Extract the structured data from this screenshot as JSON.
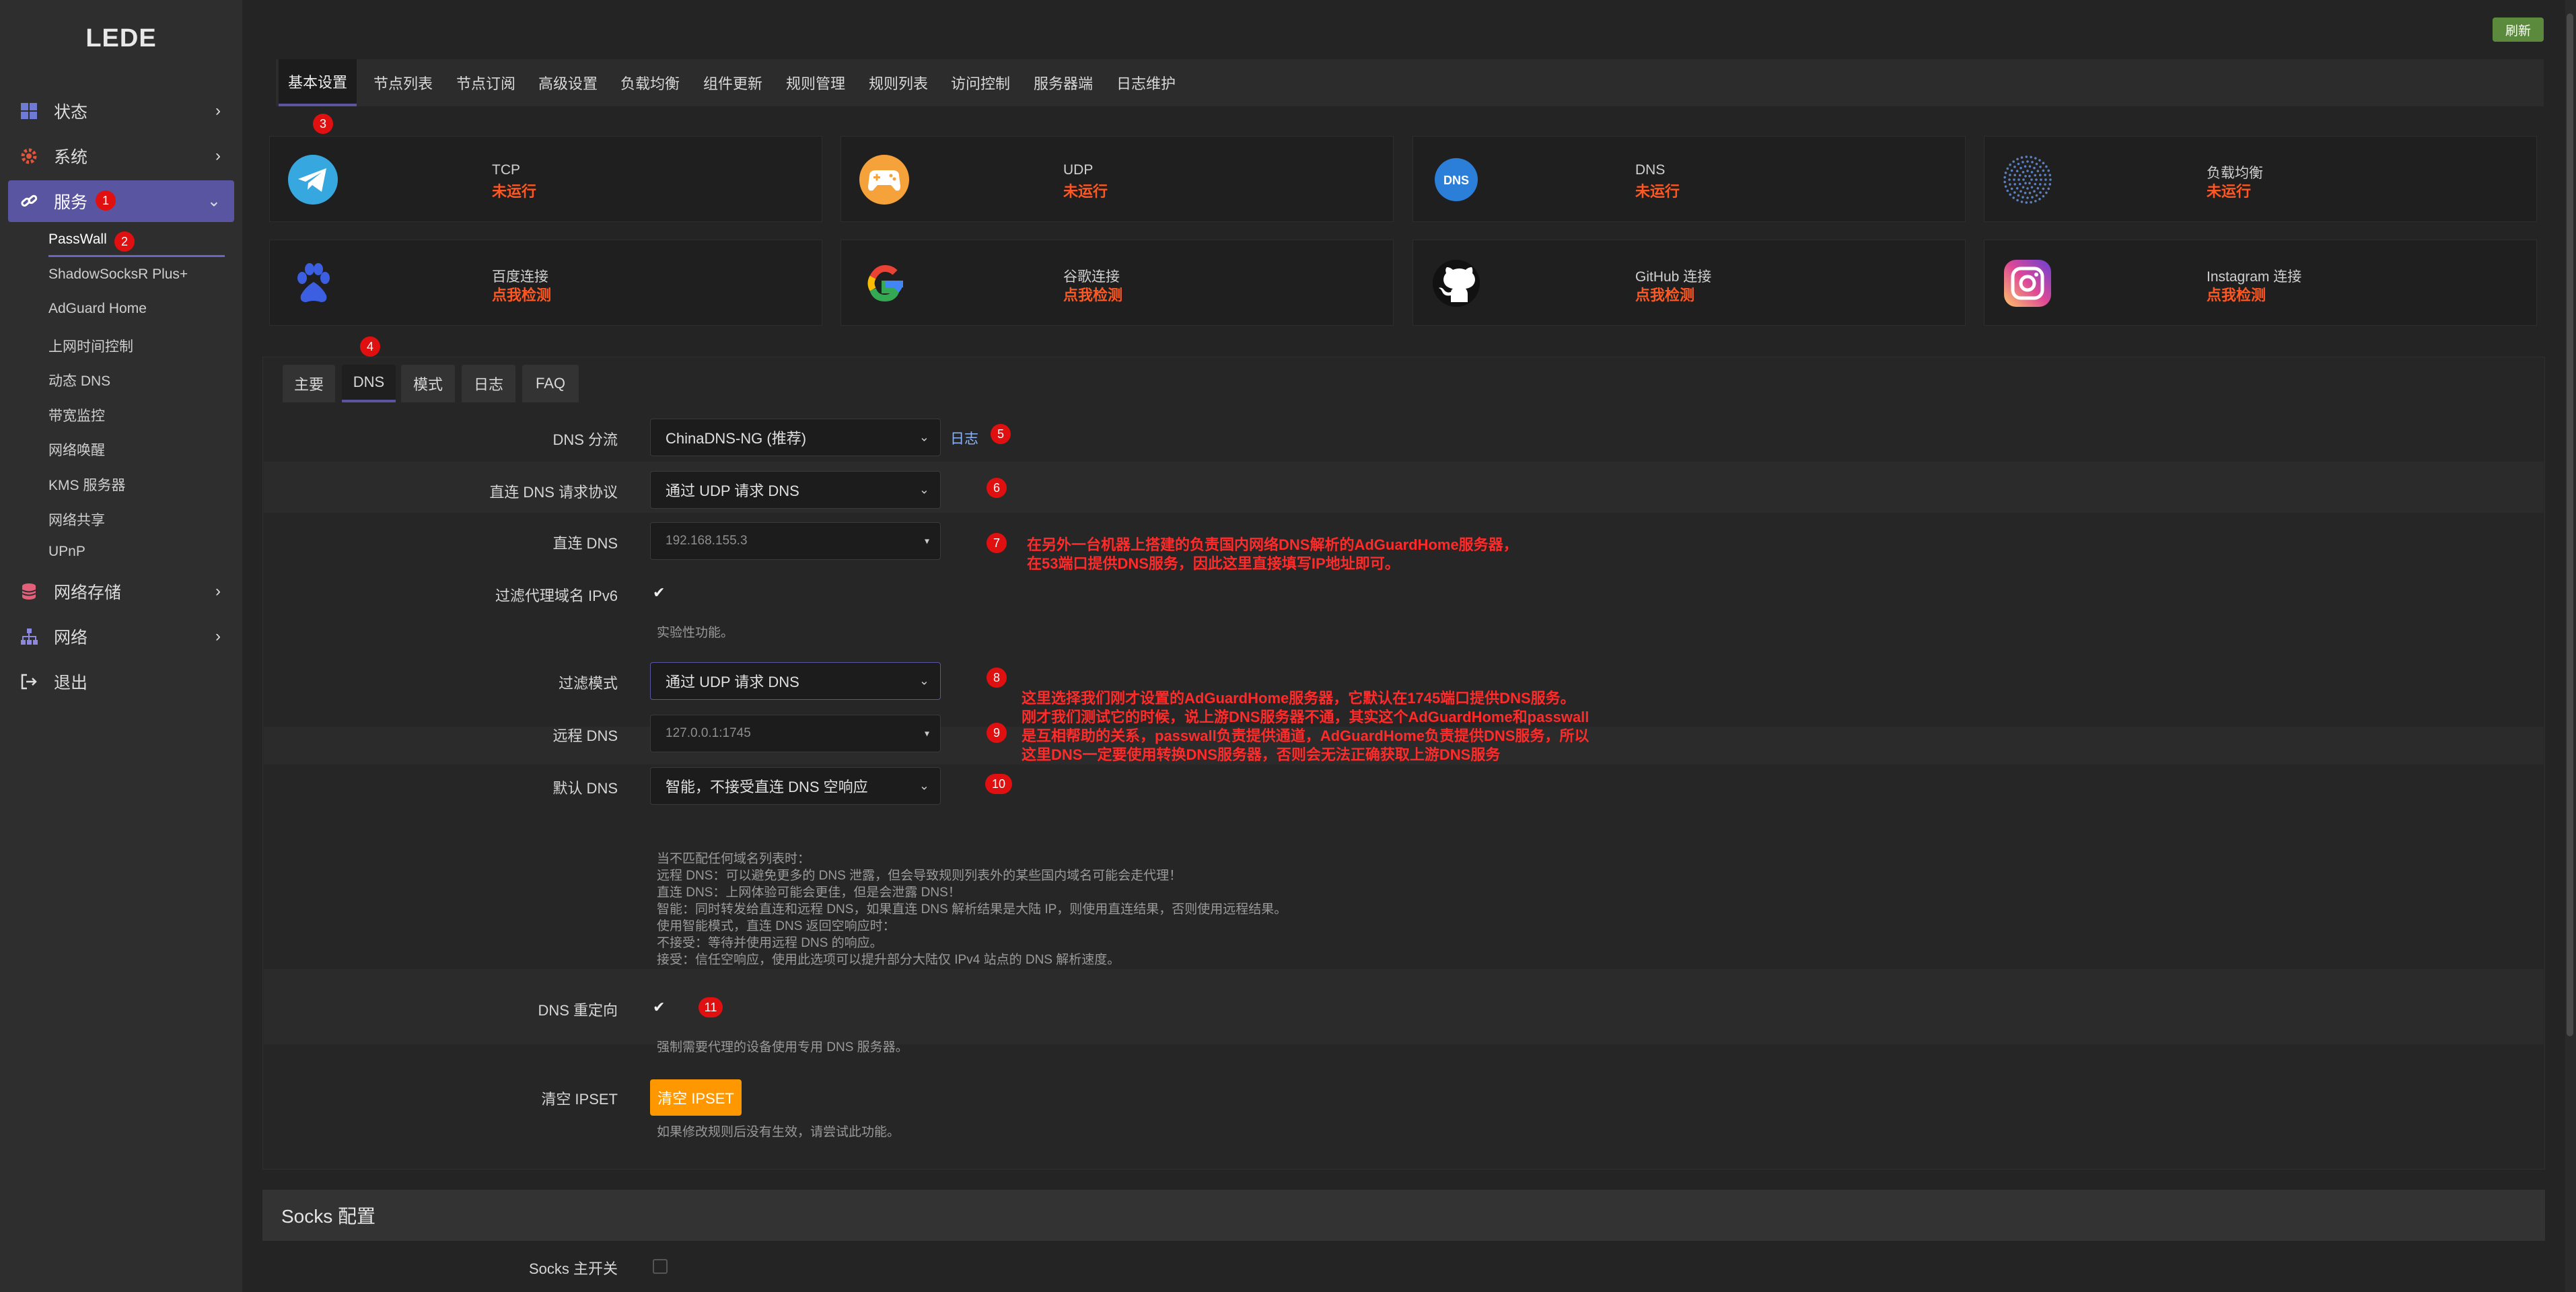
{
  "app": {
    "logo": "LEDE",
    "refresh": "刷新"
  },
  "sidebar": {
    "items": [
      {
        "label": "状态",
        "icon": "dashboard-icon"
      },
      {
        "label": "系统",
        "icon": "gear-icon"
      },
      {
        "label": "服务",
        "icon": "link-icon"
      },
      {
        "label": "网络存储",
        "icon": "database-icon"
      },
      {
        "label": "网络",
        "icon": "network-icon"
      },
      {
        "label": "退出",
        "icon": "logout-icon"
      }
    ],
    "services": [
      "PassWall",
      "ShadowSocksR Plus+",
      "AdGuard Home",
      "上网时间控制",
      "动态 DNS",
      "带宽监控",
      "网络唤醒",
      "KMS 服务器",
      "网络共享",
      "UPnP"
    ]
  },
  "tabs": [
    "基本设置",
    "节点列表",
    "节点订阅",
    "高级设置",
    "负载均衡",
    "组件更新",
    "规则管理",
    "规则列表",
    "访问控制",
    "服务器端",
    "日志维护"
  ],
  "status": [
    {
      "label": "TCP",
      "state": "未运行"
    },
    {
      "label": "UDP",
      "state": "未运行"
    },
    {
      "label": "DNS",
      "state": "未运行",
      "icon_text": "DNS"
    },
    {
      "label": "负载均衡",
      "state": "未运行"
    },
    {
      "label": "百度连接",
      "state": "点我检测"
    },
    {
      "label": "谷歌连接",
      "state": "点我检测"
    },
    {
      "label": "GitHub 连接",
      "state": "点我检测"
    },
    {
      "label": "Instagram 连接",
      "state": "点我检测"
    }
  ],
  "subtabs": [
    "主要",
    "DNS",
    "模式",
    "日志",
    "FAQ"
  ],
  "form": {
    "dns_split": {
      "label": "DNS 分流",
      "value": "ChinaDNS-NG (推荐)",
      "log": "日志"
    },
    "direct_protocol": {
      "label": "直连 DNS 请求协议",
      "value": "通过 UDP 请求 DNS"
    },
    "direct_dns": {
      "label": "直连 DNS",
      "value": "192.168.155.3"
    },
    "filter_ipv6": {
      "label": "过滤代理域名 IPv6",
      "help": "实验性功能。"
    },
    "filter_mode": {
      "label": "过滤模式",
      "value": "通过 UDP 请求 DNS"
    },
    "remote_dns": {
      "label": "远程 DNS",
      "value": "127.0.0.1:1745"
    },
    "default_dns": {
      "label": "默认 DNS",
      "value": "智能，不接受直连 DNS 空响应"
    },
    "default_help": "当不匹配任何域名列表时：\n远程 DNS：可以避免更多的 DNS 泄露，但会导致规则列表外的某些国内域名可能会走代理！\n直连 DNS：上网体验可能会更佳，但是会泄露 DNS！\n智能：同时转发给直连和远程 DNS，如果直连 DNS 解析结果是大陆 IP，则使用直连结果，否则使用远程结果。\n使用智能模式，直连 DNS 返回空响应时：\n不接受：等待并使用远程 DNS 的响应。\n接受：信任空响应，使用此选项可以提升部分大陆仅 IPv4 站点的 DNS 解析速度。",
    "dns_redirect": {
      "label": "DNS 重定向",
      "help": "强制需要代理的设备使用专用 DNS 服务器。"
    },
    "clear_ipset": {
      "label": "清空 IPSET",
      "button": "清空 IPSET",
      "help": "如果修改规则后没有生效，请尝试此功能。"
    }
  },
  "socks": {
    "title": "Socks 配置",
    "switch_label": "Socks 主开关"
  },
  "badges": [
    "1",
    "2",
    "3",
    "4",
    "5",
    "6",
    "7",
    "8",
    "9",
    "10",
    "11"
  ],
  "annotations": {
    "a7": [
      "在另外一台机器上搭建的负责国内网络DNS解析的AdGuardHome服务器，",
      "在53端口提供DNS服务，因此这里直接填写IP地址即可。"
    ],
    "a8": [
      "这里选择我们刚才设置的AdGuardHome服务器，它默认在1745端口提供DNS服务。",
      "刚才我们测试它的时候，说上游DNS服务器不通，其实这个AdGuardHome和passwall",
      "是互相帮助的关系，passwall负责提供通道，AdGuardHome负责提供DNS服务，所以",
      "这里DNS一定要使用转换DNS服务器，否则会无法正确获取上游DNS服务"
    ]
  },
  "colors": {
    "accent": "#5a55a0",
    "danger": "#ff5722",
    "annotation": "#ff2a2a",
    "button": "#ff9800"
  }
}
